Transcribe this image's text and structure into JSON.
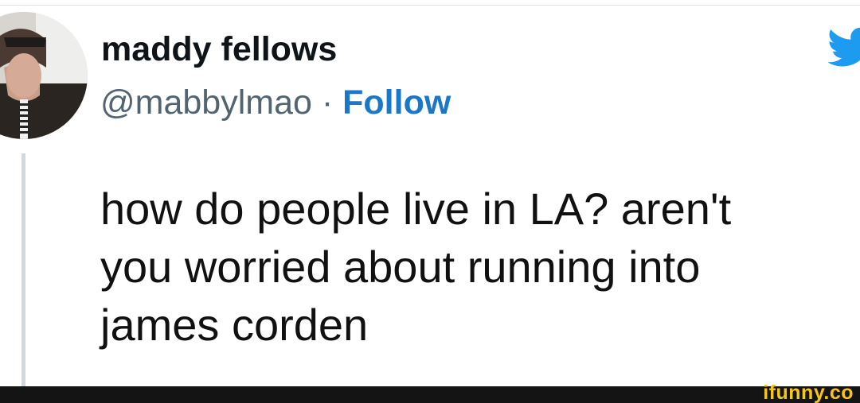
{
  "tweet": {
    "display_name": "maddy fellows",
    "handle": "@mabbylmao",
    "separator": " · ",
    "follow_label": "Follow",
    "text_lines": [
      "how do people live in LA? aren't",
      "you worried about running into",
      "james corden"
    ]
  },
  "icons": {
    "avatar": "user-avatar",
    "brand": "twitter-bird-icon"
  },
  "watermark": {
    "text": "ifunny.co"
  },
  "colors": {
    "follow": "#1b78c9",
    "twitter_blue": "#1d9bf0",
    "handle_gray": "#536471",
    "watermark_yellow": "#f5c518"
  }
}
